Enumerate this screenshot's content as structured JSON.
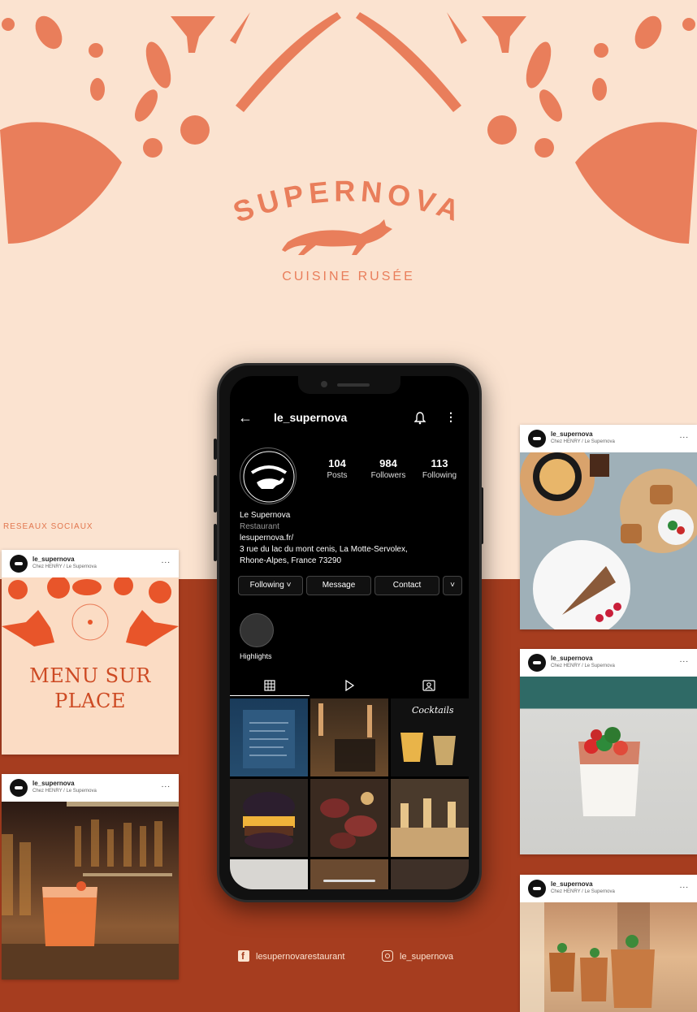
{
  "brand": {
    "name": "SUPERNOVA",
    "tagline": "CUISINE RUSÉE",
    "section_label": "RESEAUX SOCIAUX"
  },
  "colors": {
    "background": "#fbe3d0",
    "accent": "#e97e5b",
    "band": "#a63d1f"
  },
  "profile": {
    "username": "le_supernova",
    "stats": [
      {
        "value": "104",
        "label": "Posts"
      },
      {
        "value": "984",
        "label": "Followers"
      },
      {
        "value": "113",
        "label": "Following"
      }
    ],
    "bio": {
      "name": "Le Supernova",
      "category": "Restaurant",
      "website": "lesupernova.fr/",
      "address_1": "3 rue du lac du mont cenis, La Motte-Servolex,",
      "address_2": "Rhone-Alpes, France 73290"
    },
    "buttons": {
      "following": "Following",
      "message": "Message",
      "contact": "Contact"
    },
    "highlights_label": "Highlights",
    "grid_overlay_cocktails": "Cocktails"
  },
  "posts": {
    "username": "le_supernova",
    "subtitle": "Chez HENRY / Le Supernova",
    "more": "...",
    "menu_line_1": "MENU SUR",
    "menu_line_2": "PLACE"
  },
  "social": {
    "facebook": "lesupernovarestaurant",
    "instagram": "le_supernova"
  }
}
